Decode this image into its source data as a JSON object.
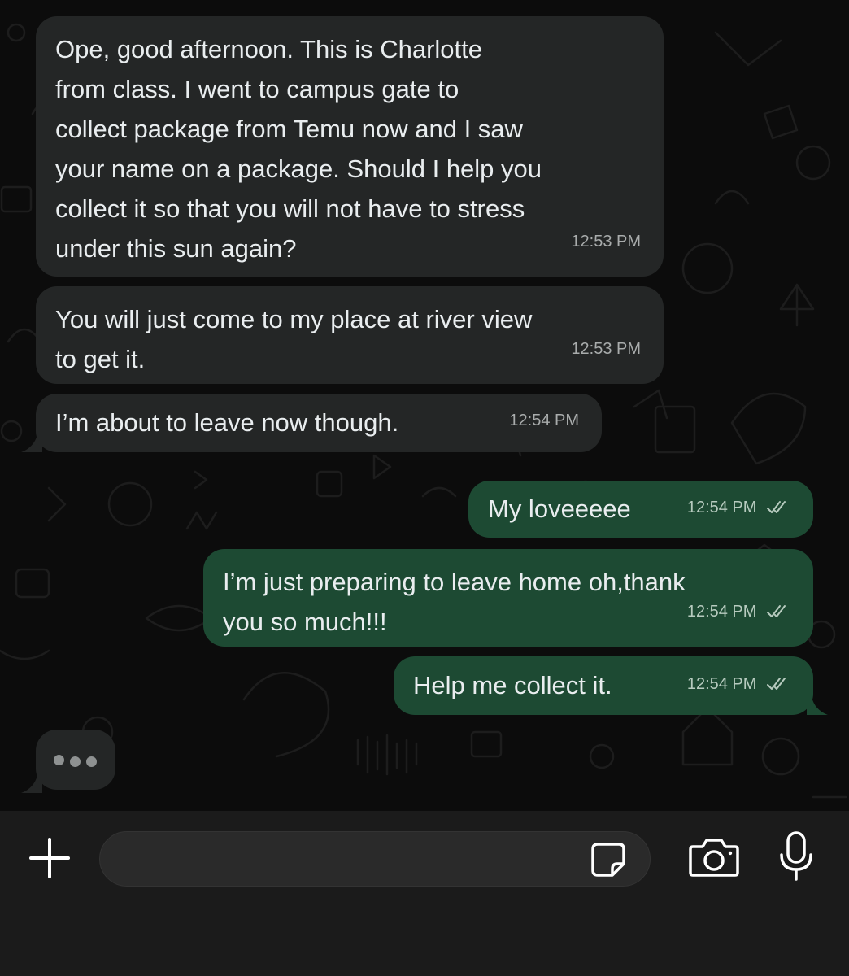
{
  "messages": [
    {
      "direction": "incoming",
      "text": "Ope, good afternoon. This is Charlotte from class. I went to campus gate to collect package from Temu now and I saw your name on a package. Should I help you collect it so that you will not have to stress under this sun again?",
      "lines": [
        "Ope, good afternoon. This is Charlotte",
        "from class. I went to campus gate to",
        "collect package from Temu now and I saw",
        "your name on a package. Should I help you",
        "collect it so that you will not have to stress",
        "under this sun again?"
      ],
      "time": "12:53 PM"
    },
    {
      "direction": "incoming",
      "lines": [
        "You will just come to my place at river view",
        "to get it."
      ],
      "time": "12:53 PM"
    },
    {
      "direction": "incoming",
      "lines": [
        "I’m about to leave now though."
      ],
      "time": "12:54 PM"
    },
    {
      "direction": "outgoing",
      "lines": [
        "My loveeeee"
      ],
      "time": "12:54 PM",
      "status": "read"
    },
    {
      "direction": "outgoing",
      "lines": [
        "I’m just preparing to leave home oh,thank",
        "you so much!!!"
      ],
      "time": "12:54 PM",
      "status": "read"
    },
    {
      "direction": "outgoing",
      "lines": [
        "Help me collect it."
      ],
      "time": "12:54 PM",
      "status": "read"
    }
  ],
  "typing_indicator": {
    "visible": true,
    "icon": "typing-dots-icon"
  },
  "composer": {
    "placeholder": "",
    "icons": [
      "plus-icon",
      "sticker-icon",
      "camera-icon",
      "microphone-icon"
    ]
  },
  "colors": {
    "incoming_bubble": "#242626",
    "outgoing_bubble": "#1d4a33",
    "background": "#0c0c0c",
    "composer_bar": "#1b1b1b"
  }
}
